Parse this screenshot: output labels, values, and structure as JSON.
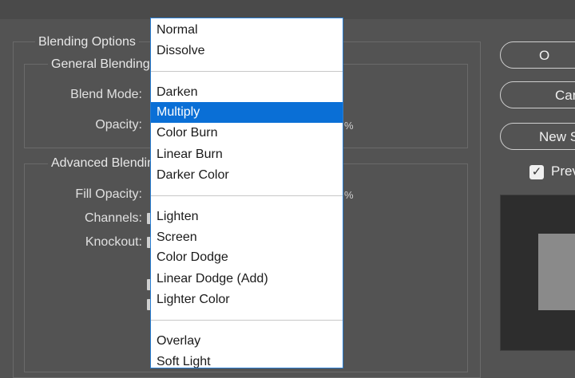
{
  "dialog": {
    "sections": {
      "blending_options": "Blending Options",
      "general_blending": "General Blending",
      "advanced_blending": "Advanced Blendin"
    },
    "labels": {
      "blend_mode": "Blend Mode:",
      "opacity": "Opacity:",
      "fill_opacity": "Fill Opacity:",
      "channels": "Channels:",
      "knockout": "Knockout:",
      "percent": "%"
    },
    "buttons": {
      "ok": "O",
      "cancel": "Can",
      "new_style": "New S"
    },
    "preview": {
      "label": "Prev",
      "checked": true
    }
  },
  "blend_dropdown": {
    "selected": "Multiply",
    "items": [
      "Normal",
      "Dissolve",
      "Darken",
      "Multiply",
      "Color Burn",
      "Linear Burn",
      "Darker Color",
      "Lighten",
      "Screen",
      "Color Dodge",
      "Linear Dodge (Add)",
      "Lighter Color",
      "Overlay",
      "Soft Light"
    ]
  }
}
